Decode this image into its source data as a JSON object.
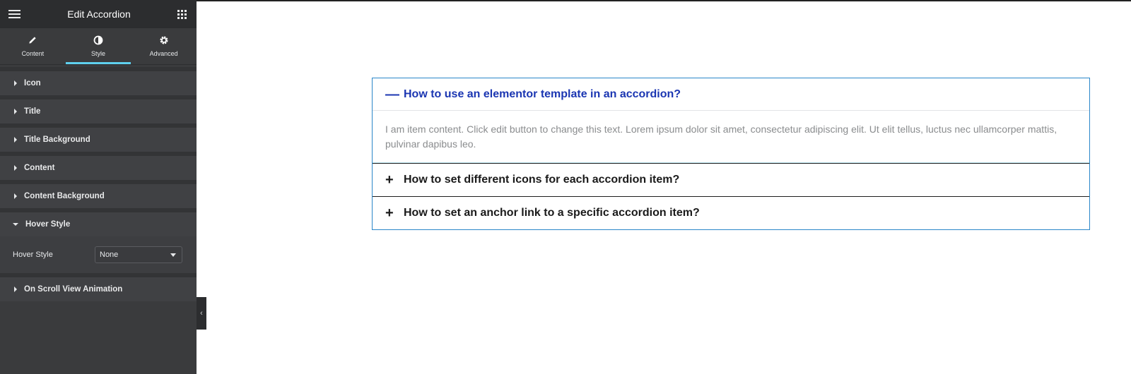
{
  "sidebar": {
    "title": "Edit Accordion",
    "tabs": [
      {
        "label": "Content",
        "icon": "pencil-icon"
      },
      {
        "label": "Style",
        "icon": "contrast-icon"
      },
      {
        "label": "Advanced",
        "icon": "gear-icon"
      }
    ],
    "active_tab": "Style",
    "sections": [
      {
        "label": "Icon"
      },
      {
        "label": "Title"
      },
      {
        "label": "Title Background"
      },
      {
        "label": "Content"
      },
      {
        "label": "Content Background"
      },
      {
        "label": "Hover Style"
      },
      {
        "label": "On Scroll View Animation"
      }
    ],
    "hover_style_control": {
      "label": "Hover Style",
      "value": "None"
    },
    "accent_color": "#5fd0ee"
  },
  "accordion": {
    "items": [
      {
        "title": "How to use an elementor template in an accordion?",
        "icon": "minus-icon",
        "open": true,
        "content": "I am item content. Click edit button to change this text. Lorem ipsum dolor sit amet, consectetur adipiscing elit. Ut elit tellus, luctus nec ullamcorper mattis, pulvinar dapibus leo."
      },
      {
        "title": "How to set different icons for each accordion item?",
        "icon": "plus-icon",
        "open": false
      },
      {
        "title": "How to set an anchor link to a specific accordion item?",
        "icon": "plus-icon",
        "open": false
      }
    ],
    "active_title_color": "#1b36b2",
    "border_color": "#2a86c9"
  }
}
